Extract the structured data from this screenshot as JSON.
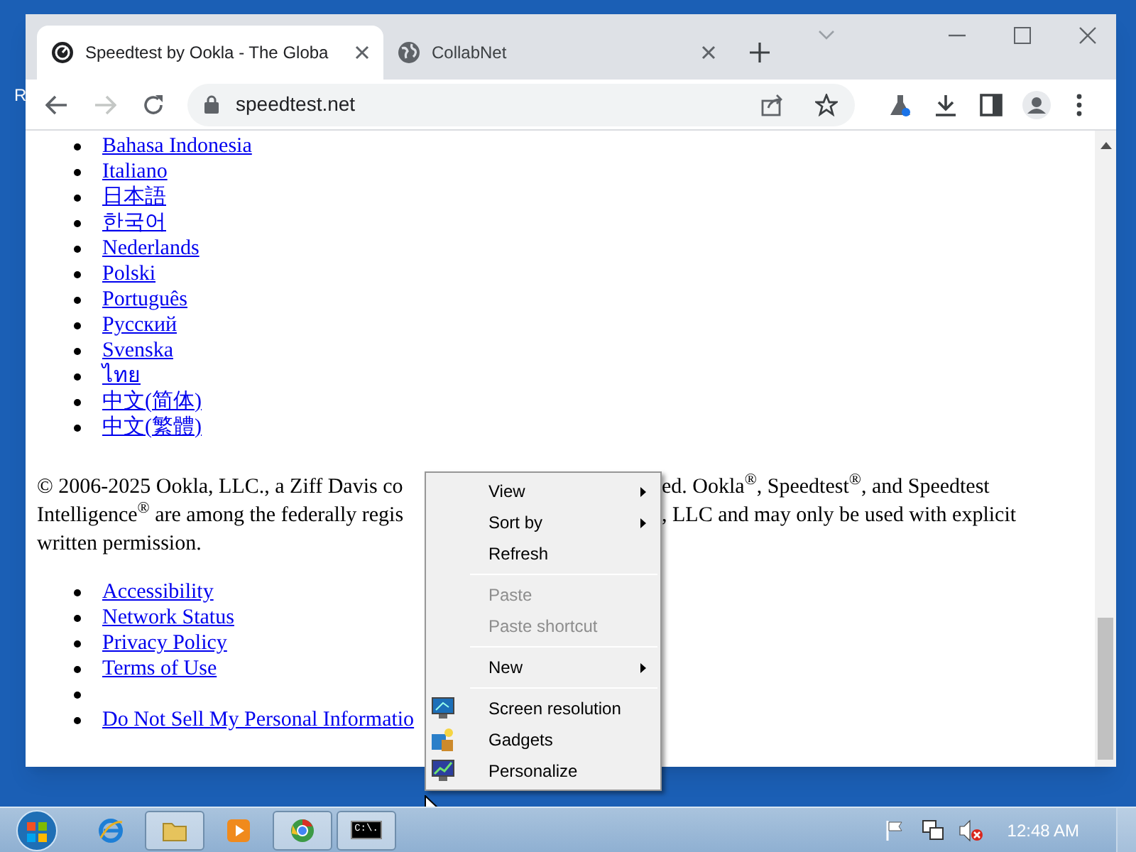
{
  "desktop": {
    "icon_label": "R"
  },
  "browser": {
    "tabs": [
      {
        "title": "Speedtest by Ookla - The Globa",
        "selected": true
      },
      {
        "title": "CollabNet",
        "selected": false
      }
    ],
    "address": "speedtest.net"
  },
  "page": {
    "languages": [
      "Bahasa Indonesia",
      "Italiano",
      "日本語",
      "한국어",
      "Nederlands",
      "Polski",
      "Português",
      "Русский",
      "Svenska",
      "ไทย",
      "中文(简体)",
      "中文(繁體)"
    ],
    "copyright_lines": [
      {
        "left": "© 2006-2025 Ookla, LLC., a Ziff Davis co",
        "right": "ed. Ookla$^{®}$, Speedtest$^{®}$, and Speedtest"
      },
      {
        "left": "Intelligence$^{®}$ are among the federally regis",
        "right": ", LLC and may only be used with explicit"
      },
      {
        "left": "written permission."
      }
    ],
    "footer_links": [
      {
        "kind": "link",
        "text": "Accessibility"
      },
      {
        "kind": "link",
        "text": "Network Status"
      },
      {
        "kind": "link",
        "text": "Privacy Policy"
      },
      {
        "kind": "link",
        "text": "Terms of Use"
      },
      {
        "kind": "blank"
      },
      {
        "kind": "link",
        "text": "Do Not Sell My Personal Informatio"
      }
    ]
  },
  "context_menu": [
    {
      "kind": "item",
      "label": "View",
      "submenu": true,
      "disabled": false
    },
    {
      "kind": "item",
      "label": "Sort by",
      "submenu": true,
      "disabled": false
    },
    {
      "kind": "item",
      "label": "Refresh",
      "submenu": false,
      "disabled": false
    },
    {
      "kind": "separator"
    },
    {
      "kind": "item",
      "label": "Paste",
      "submenu": false,
      "disabled": true
    },
    {
      "kind": "item",
      "label": "Paste shortcut",
      "submenu": false,
      "disabled": true
    },
    {
      "kind": "separator"
    },
    {
      "kind": "item",
      "label": "New",
      "submenu": true,
      "disabled": false
    },
    {
      "kind": "separator"
    },
    {
      "kind": "icon_item",
      "label": "Screen resolution",
      "submenu": false,
      "disabled": false
    },
    {
      "kind": "icon_item",
      "label": "Gadgets",
      "submenu": false,
      "disabled": false
    },
    {
      "kind": "icon_item",
      "label": "Personalize",
      "submenu": false,
      "disabled": false
    }
  ],
  "taskbar": {
    "apps": [
      {
        "running": false
      },
      {
        "running": true
      },
      {
        "running": false
      },
      {
        "running": true
      },
      {
        "running": true,
        "label": "C:\\."
      }
    ],
    "clock": "12:48 AM"
  }
}
